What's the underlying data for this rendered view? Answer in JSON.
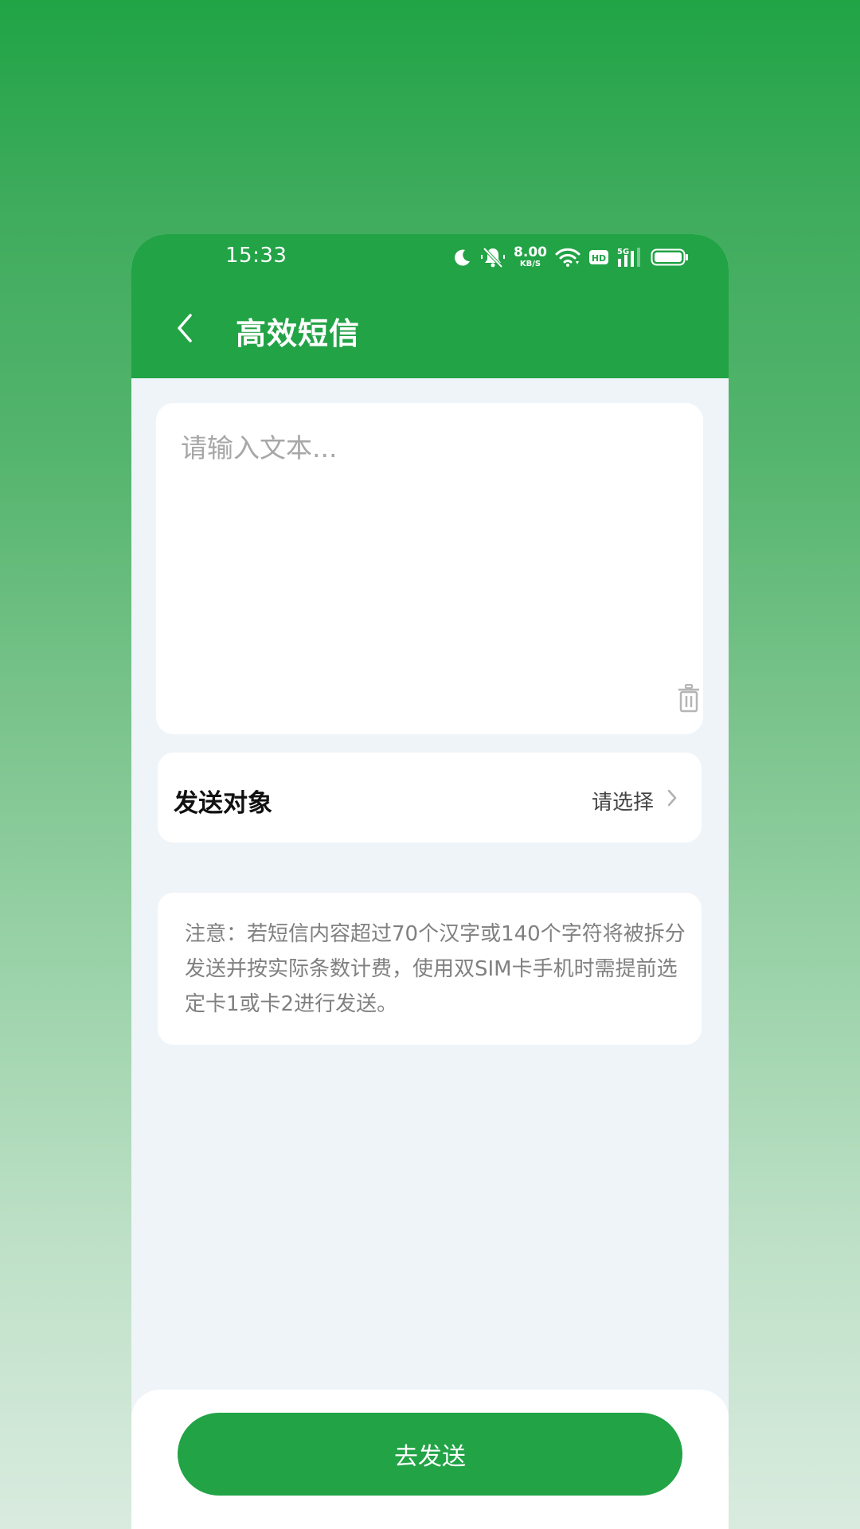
{
  "status_bar": {
    "time": "15:33",
    "net_speed_value": "8.00",
    "net_speed_unit": "KB/S",
    "icons": [
      "moon-icon",
      "mute-icon",
      "wifi-icon",
      "hd-icon",
      "signal-5g-icon",
      "battery-icon"
    ],
    "network_label": "5G",
    "hd_label": "HD"
  },
  "header": {
    "title": "高效短信",
    "back_icon": "chevron-left-icon"
  },
  "message": {
    "placeholder": "请输入文本...",
    "value": "",
    "clear_icon": "trash-icon"
  },
  "recipient": {
    "label": "发送对象",
    "value": "请选择",
    "arrow_icon": "chevron-right-icon"
  },
  "notice": {
    "text": "注意：若短信内容超过70个汉字或140个字符将被拆分发送并按实际条数计费，使用双SIM卡手机时需提前选定卡1或卡2进行发送。"
  },
  "footer": {
    "send_label": "去发送"
  },
  "colors": {
    "primary": "#22a346",
    "page_bg": "#eff4f9",
    "card_bg": "#ffffff",
    "placeholder": "#a7a7a7",
    "notice_text": "#808080"
  }
}
